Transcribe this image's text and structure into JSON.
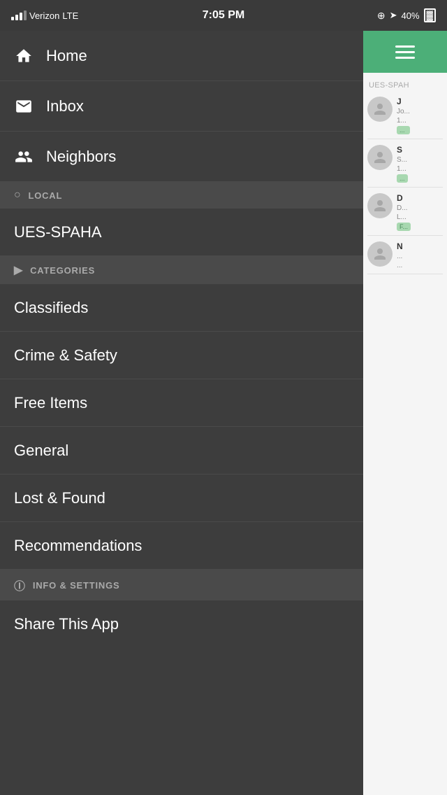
{
  "statusBar": {
    "carrier": "Verizon",
    "networkType": "LTE",
    "time": "7:05 PM",
    "batteryPercent": "40%"
  },
  "sidebar": {
    "navItems": [
      {
        "id": "home",
        "label": "Home",
        "icon": "home-icon"
      },
      {
        "id": "inbox",
        "label": "Inbox",
        "icon": "inbox-icon"
      },
      {
        "id": "neighbors",
        "label": "Neighbors",
        "icon": "neighbors-icon"
      }
    ],
    "sections": [
      {
        "id": "local",
        "headerLabel": "LOCAL",
        "headerIcon": "location-pin-icon",
        "items": [
          {
            "id": "ues-spaha",
            "label": "UES-SPAHA"
          }
        ]
      },
      {
        "id": "categories",
        "headerLabel": "CATEGORIES",
        "headerIcon": "tag-icon",
        "items": [
          {
            "id": "classifieds",
            "label": "Classifieds"
          },
          {
            "id": "crime-safety",
            "label": "Crime & Safety"
          },
          {
            "id": "free-items",
            "label": "Free Items"
          },
          {
            "id": "general",
            "label": "General"
          },
          {
            "id": "lost-found",
            "label": "Lost & Found"
          },
          {
            "id": "recommendations",
            "label": "Recommendations"
          }
        ]
      },
      {
        "id": "info-settings",
        "headerLabel": "INFO & SETTINGS",
        "headerIcon": "info-icon",
        "items": [
          {
            "id": "share-app",
            "label": "Share This App"
          }
        ]
      }
    ]
  },
  "rightPanel": {
    "neighborhoodLabel": "UES-SPAH",
    "posts": [
      {
        "initials": "J",
        "name": "J...",
        "subtext": "Jo...",
        "date": "1...",
        "tag": "..."
      },
      {
        "initials": "S",
        "name": "S...",
        "subtext": "S...",
        "date": "1...",
        "tag": "..."
      },
      {
        "initials": "D",
        "name": "D...",
        "subtext": "D...",
        "date": "L...",
        "tag": "F..."
      },
      {
        "initials": "N",
        "name": "N...",
        "subtext": "...",
        "date": "...",
        "tag": ""
      }
    ]
  },
  "colors": {
    "sidebarBg": "#3d3d3d",
    "sectionHeaderBg": "#4a4a4a",
    "greenAccent": "#4caf78",
    "statusBarBg": "#3a3a3a"
  }
}
